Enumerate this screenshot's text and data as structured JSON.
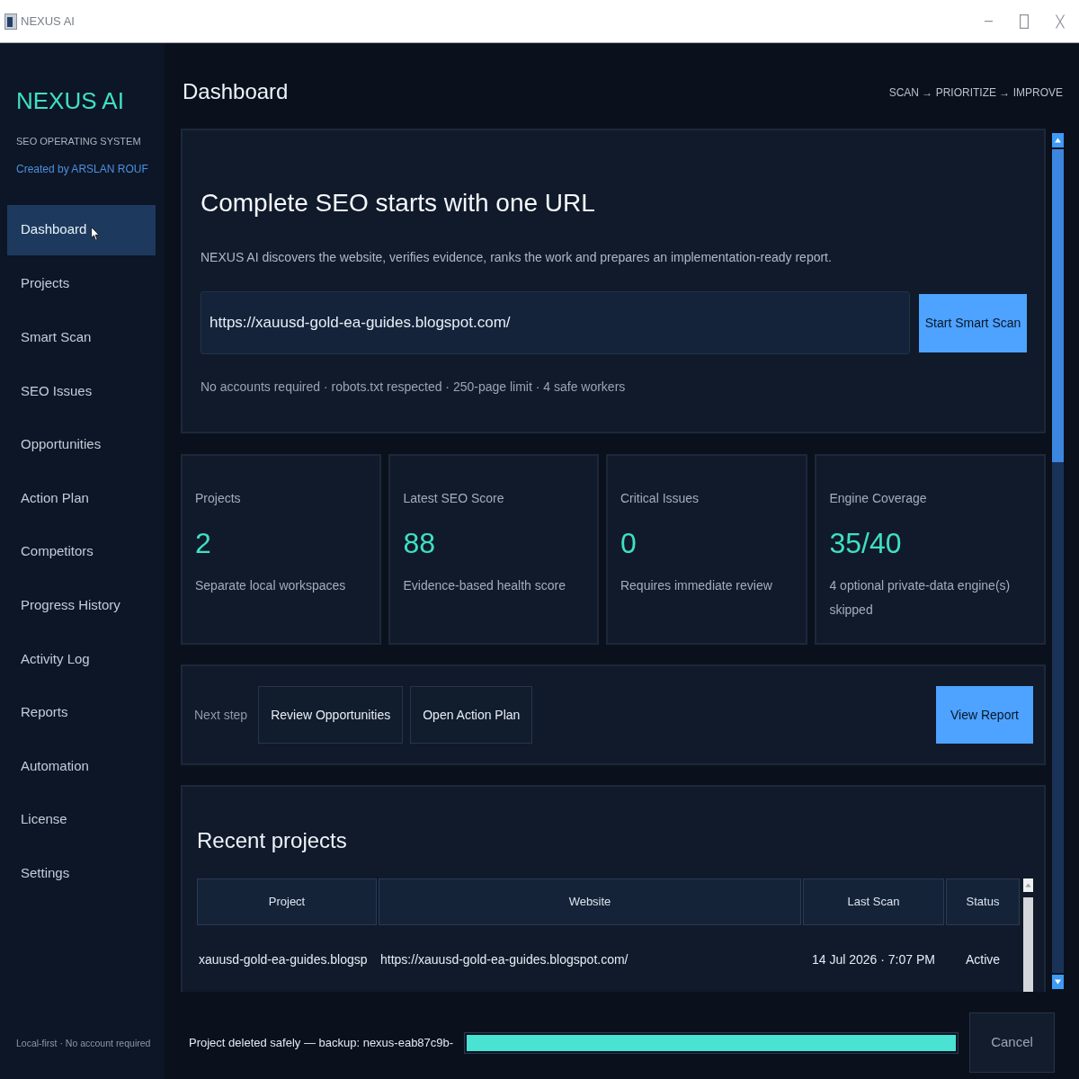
{
  "window": {
    "title": "NEXUS AI"
  },
  "sidebar": {
    "brand": "NEXUS AI",
    "tagline": "SEO OPERATING SYSTEM",
    "credit": "Created by ARSLAN ROUF",
    "items": [
      {
        "label": "Dashboard",
        "selected": true,
        "hovered": true
      },
      {
        "label": "Projects",
        "selected": false,
        "hovered": false
      },
      {
        "label": "Smart Scan",
        "selected": false,
        "hovered": false
      },
      {
        "label": "SEO Issues",
        "selected": false,
        "hovered": false
      },
      {
        "label": "Opportunities",
        "selected": false,
        "hovered": false
      },
      {
        "label": "Action Plan",
        "selected": false,
        "hovered": false
      },
      {
        "label": "Competitors",
        "selected": false,
        "hovered": false
      },
      {
        "label": "Progress History",
        "selected": false,
        "hovered": false
      },
      {
        "label": "Activity Log",
        "selected": false,
        "hovered": false
      },
      {
        "label": "Reports",
        "selected": false,
        "hovered": false
      },
      {
        "label": "Automation",
        "selected": false,
        "hovered": false
      },
      {
        "label": "License",
        "selected": false,
        "hovered": false
      },
      {
        "label": "Settings",
        "selected": false,
        "hovered": false
      }
    ],
    "footer": "Local-first · No account required"
  },
  "header": {
    "title": "Dashboard",
    "workflow": "SCAN → PRIORITIZE → IMPROVE"
  },
  "hero": {
    "title": "Complete SEO starts with one URL",
    "description": "NEXUS AI discovers the website, verifies evidence, ranks the work and prepares an implementation-ready report.",
    "url_field": {
      "value": "https://xauusd-gold-ea-guides.blogspot.com/"
    },
    "button": "Start Smart Scan",
    "note": "No accounts required · robots.txt respected · 250-page limit · 4 safe workers"
  },
  "stats": [
    {
      "label": "Projects",
      "value": "2",
      "detail": "Separate local workspaces"
    },
    {
      "label": "Latest SEO Score",
      "value": "88",
      "detail": "Evidence-based health score"
    },
    {
      "label": "Critical Issues",
      "value": "0",
      "detail": "Requires immediate review"
    },
    {
      "label": "Engine Coverage",
      "value": "35/40",
      "detail": "4 optional private-data engine(s) skipped"
    }
  ],
  "next_step": {
    "label": "Next step",
    "actions": [
      {
        "label": "Review Opportunities",
        "kind": "secondary"
      },
      {
        "label": "Open Action Plan",
        "kind": "secondary"
      },
      {
        "label": "View Report",
        "kind": "primary"
      }
    ]
  },
  "recent_projects": {
    "title": "Recent projects",
    "table": {
      "columns": [
        "Project",
        "Website",
        "Last Scan",
        "Status"
      ],
      "rows": [
        [
          "xauusd-gold-ea-guides.blogsp",
          "https://xauusd-gold-ea-guides.blogspot.com/",
          "14 Jul 2026 · 7:07 PM",
          "Active"
        ]
      ]
    }
  },
  "status_bar": {
    "message": "Project deleted safely — backup: nexus-eab87c9b-",
    "progress": {
      "level": 1
    },
    "button": "Cancel"
  }
}
